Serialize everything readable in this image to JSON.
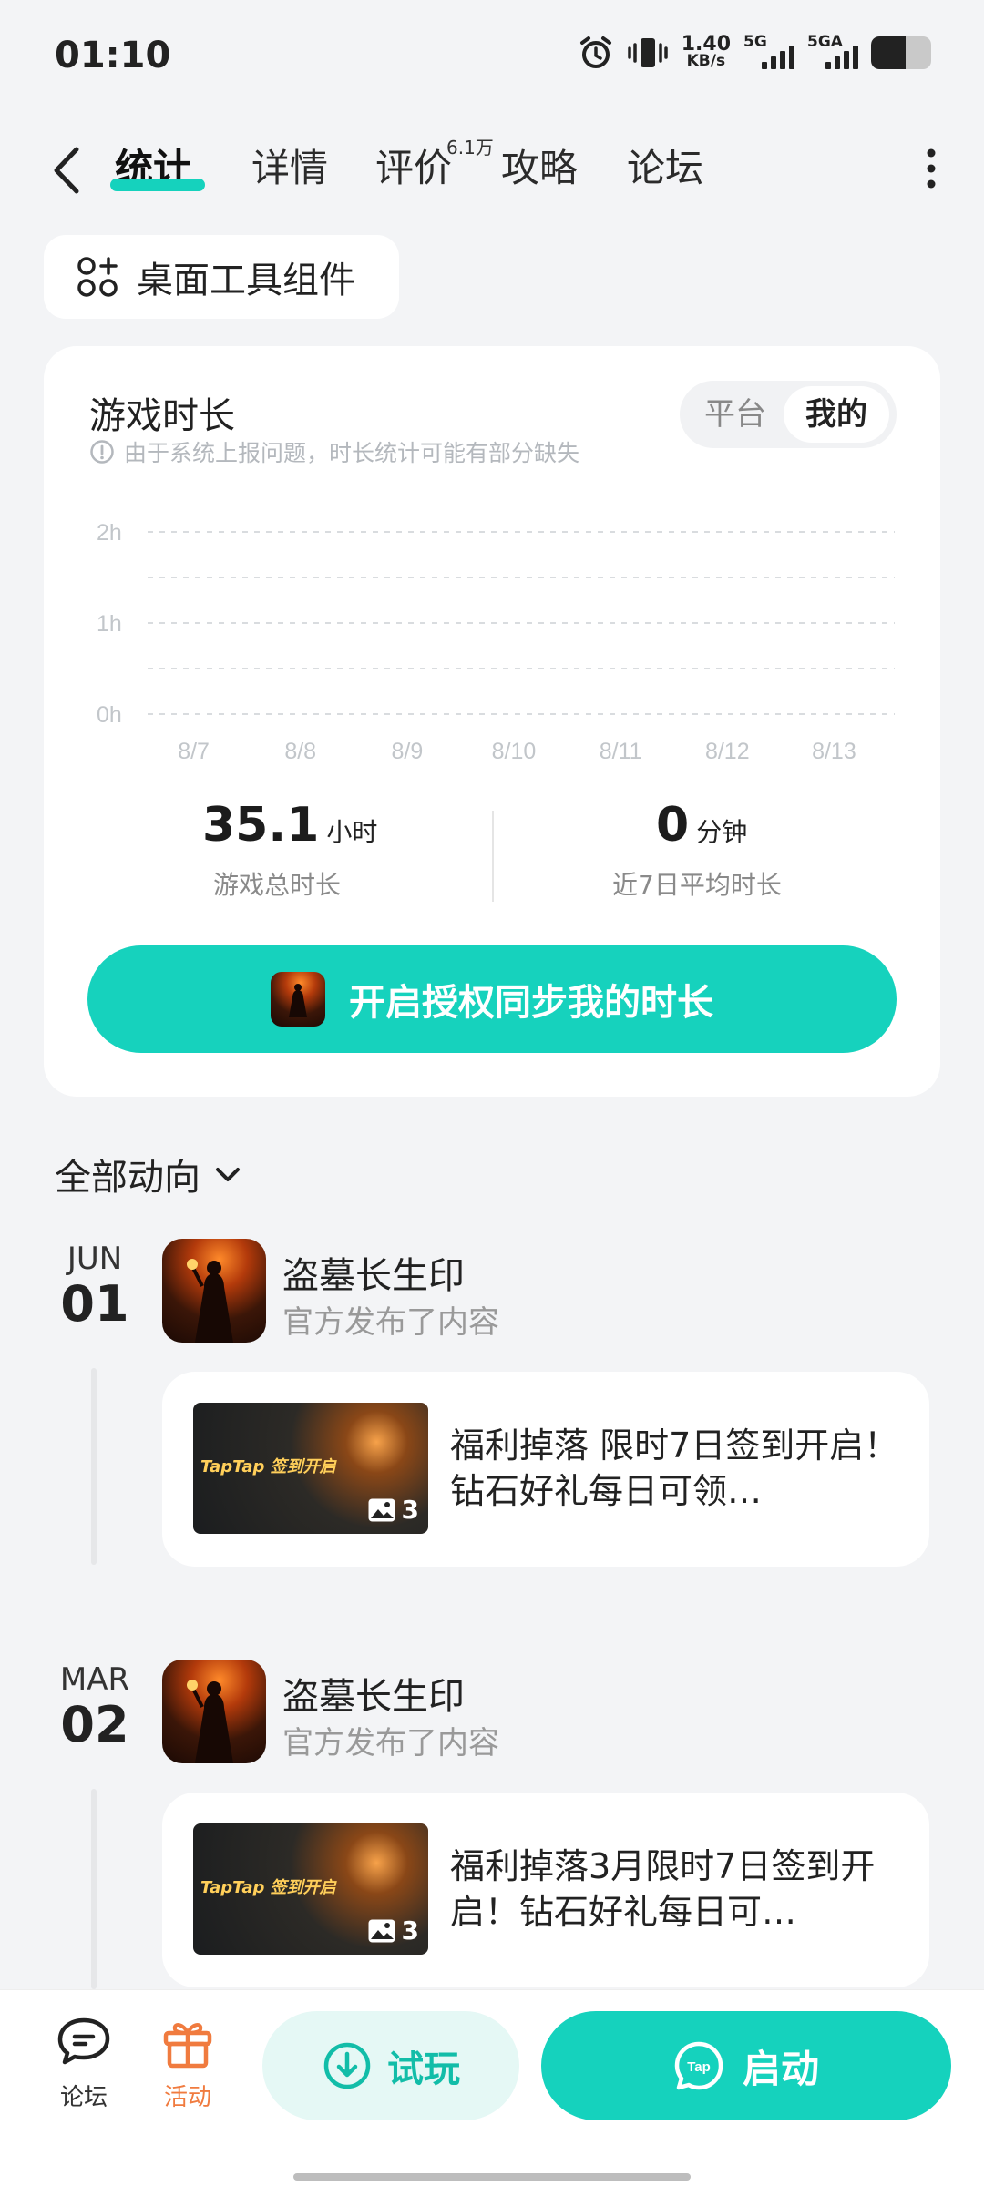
{
  "status": {
    "time": "01:10",
    "net_speed_value": "1.40",
    "net_speed_unit": "KB/s",
    "sim1": "5G",
    "sim2": "5GA"
  },
  "nav": {
    "tabs": [
      {
        "label": "统计",
        "active": true
      },
      {
        "label": "详情"
      },
      {
        "label": "评价",
        "badge": "6.1万"
      },
      {
        "label": "攻略"
      },
      {
        "label": "论坛"
      }
    ]
  },
  "widget_button": {
    "label": "桌面工具组件",
    "icon": "widget-grid-icon"
  },
  "stats": {
    "title": "游戏时长",
    "note": "由于系统上报问题，时长统计可能有部分缺失",
    "segment": {
      "options": [
        "平台",
        "我的"
      ],
      "selected": "我的"
    },
    "total_value": "35.1",
    "total_unit": "小时",
    "total_label": "游戏总时长",
    "avg_value": "0",
    "avg_unit": "分钟",
    "avg_label": "近7日平均时长",
    "sync_button": "开启授权同步我的时长"
  },
  "chart_data": {
    "type": "bar",
    "categories": [
      "8/7",
      "8/8",
      "8/9",
      "8/10",
      "8/11",
      "8/12",
      "8/13"
    ],
    "values": [
      0,
      0,
      0,
      0,
      0,
      0,
      0
    ],
    "y_ticks": [
      "2h",
      "1h",
      "0h"
    ],
    "ylim": [
      0,
      2
    ],
    "grid": true
  },
  "feed": {
    "filter_label": "全部动向",
    "items": [
      {
        "month": "JUN",
        "day": "01",
        "game": "盗墓长生印",
        "action": "官方发布了内容",
        "post_title": "福利掉落 限时7日签到开启！钻石好礼每日可领…",
        "image_count": "3",
        "image_brand": "TapTap 签到开启"
      },
      {
        "month": "MAR",
        "day": "02",
        "game": "盗墓长生印",
        "action": "官方发布了内容",
        "post_title": "福利掉落3月限时7日签到开启！钻石好礼每日可…",
        "image_count": "3",
        "image_brand": "TapTap 签到开启"
      }
    ]
  },
  "bottom_bar": {
    "forum_label": "论坛",
    "event_label": "活动",
    "try_label": "试玩",
    "launch_label": "启动",
    "launch_badge": "Tap"
  },
  "colors": {
    "accent": "#15d2bd",
    "accent_light": "#e5f8f5",
    "event_orange": "#f07b3f",
    "background": "#f3f4f6"
  }
}
